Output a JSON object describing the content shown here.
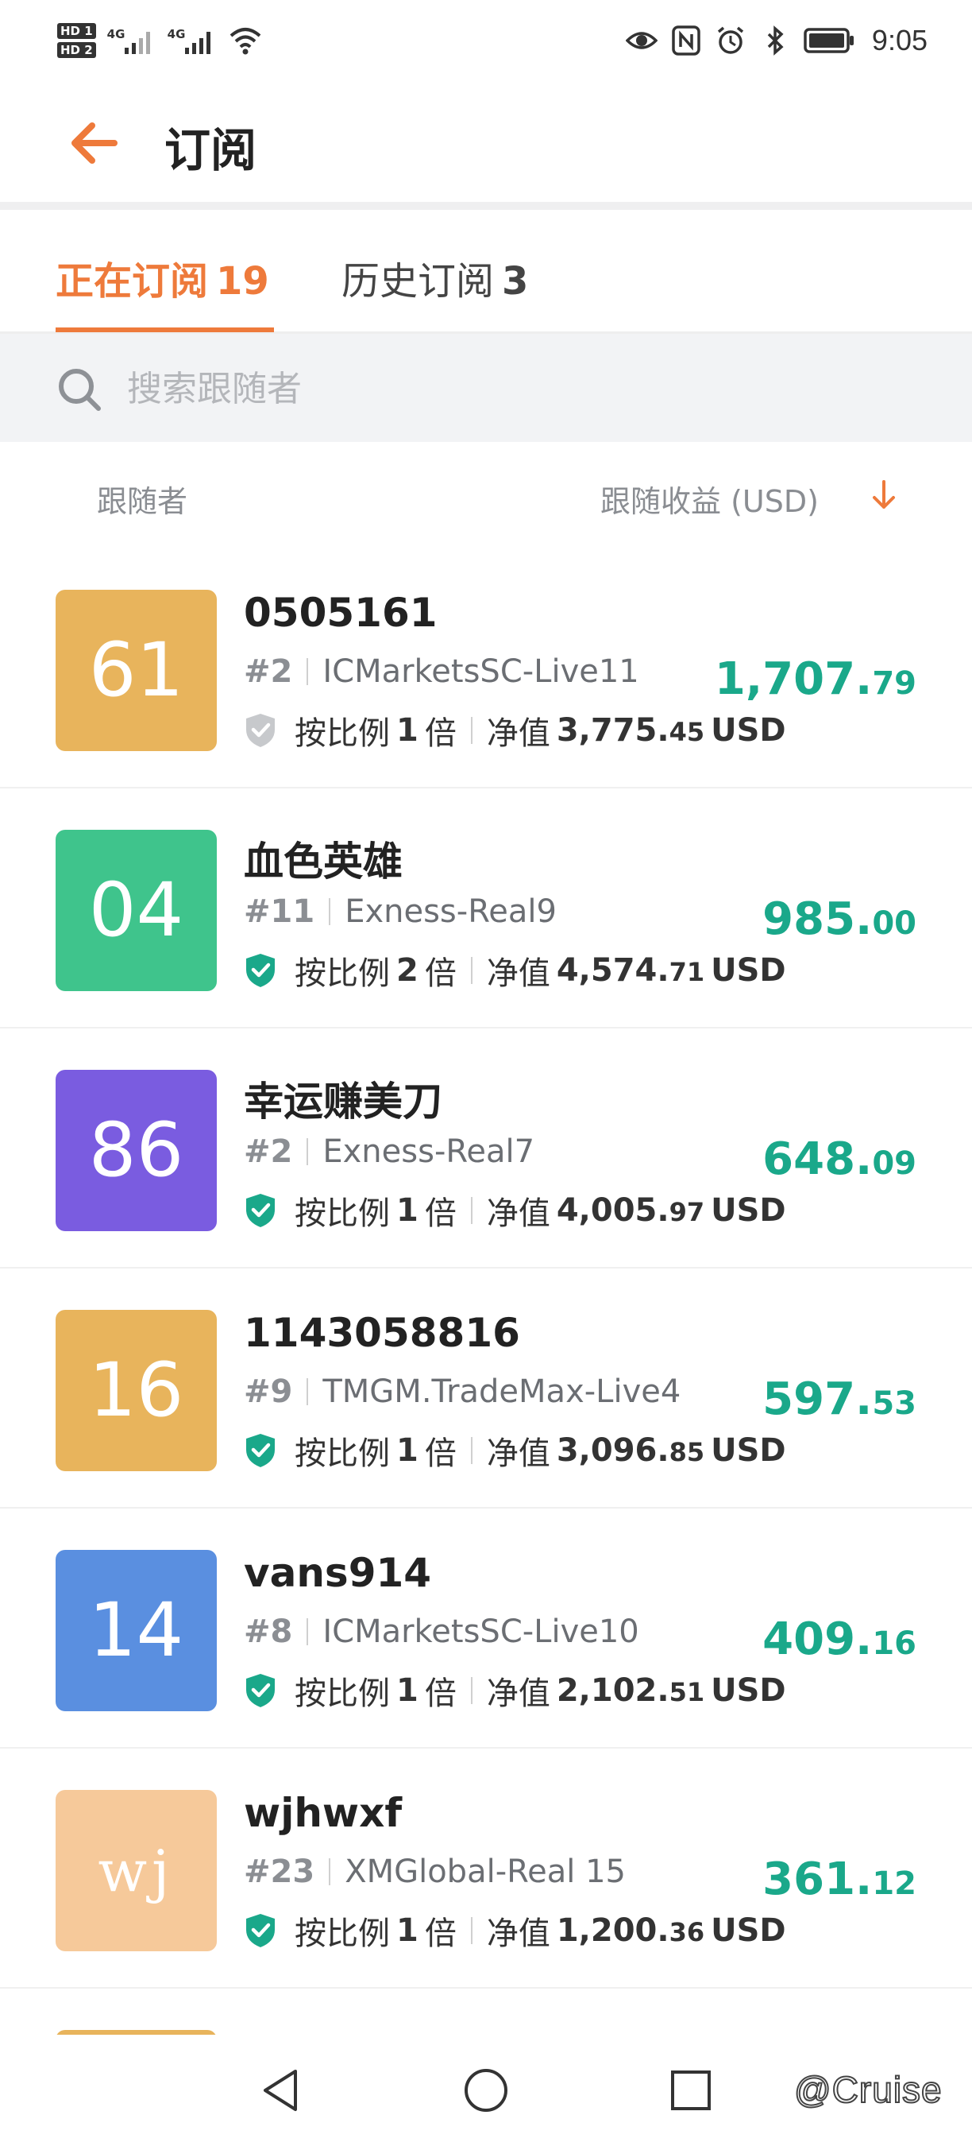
{
  "status_bar": {
    "hd1": "HD 1",
    "hd2": "HD 2",
    "network1": "4G",
    "network2": "4G",
    "time": "9:05"
  },
  "header": {
    "title": "订阅"
  },
  "tabs": [
    {
      "label": "正在订阅",
      "count": "19",
      "active": true
    },
    {
      "label": "历史订阅",
      "count": "3",
      "active": false
    }
  ],
  "search": {
    "placeholder": "搜索跟随者"
  },
  "list_header": {
    "left": "跟随者",
    "right": "跟随收益 (USD)"
  },
  "items": [
    {
      "avatar": "61",
      "avatar_color": "#e8b45c",
      "name": "0505161",
      "rank": "#2",
      "server": "ICMarketsSC-Live11",
      "verified": false,
      "ratio_label": "按比例",
      "ratio": "1",
      "ratio_unit": "倍",
      "equity_label": "净值",
      "equity_int": "3,775.",
      "equity_dec": "45",
      "currency": "USD",
      "earn_int": "1,707.",
      "earn_dec": "79"
    },
    {
      "avatar": "04",
      "avatar_color": "#3fc48c",
      "name": "血色英雄",
      "rank": "#11",
      "server": "Exness-Real9",
      "verified": true,
      "ratio_label": "按比例",
      "ratio": "2",
      "ratio_unit": "倍",
      "equity_label": "净值",
      "equity_int": "4,574.",
      "equity_dec": "71",
      "currency": "USD",
      "earn_int": "985.",
      "earn_dec": "00"
    },
    {
      "avatar": "86",
      "avatar_color": "#7a5ce0",
      "name": "幸运赚美刀",
      "rank": "#2",
      "server": "Exness-Real7",
      "verified": true,
      "ratio_label": "按比例",
      "ratio": "1",
      "ratio_unit": "倍",
      "equity_label": "净值",
      "equity_int": "4,005.",
      "equity_dec": "97",
      "currency": "USD",
      "earn_int": "648.",
      "earn_dec": "09"
    },
    {
      "avatar": "16",
      "avatar_color": "#e8b45c",
      "name": "1143058816",
      "rank": "#9",
      "server": "TMGM.TradeMax-Live4",
      "verified": true,
      "ratio_label": "按比例",
      "ratio": "1",
      "ratio_unit": "倍",
      "equity_label": "净值",
      "equity_int": "3,096.",
      "equity_dec": "85",
      "currency": "USD",
      "earn_int": "597.",
      "earn_dec": "53"
    },
    {
      "avatar": "14",
      "avatar_color": "#5a8fe0",
      "name": "vans914",
      "rank": "#8",
      "server": "ICMarketsSC-Live10",
      "verified": true,
      "ratio_label": "按比例",
      "ratio": "1",
      "ratio_unit": "倍",
      "equity_label": "净值",
      "equity_int": "2,102.",
      "equity_dec": "51",
      "currency": "USD",
      "earn_int": "409.",
      "earn_dec": "16"
    },
    {
      "avatar": "wj",
      "avatar_color": "#f6c99a",
      "name": "wjhwxf",
      "rank": "#23",
      "server": "XMGlobal-Real 15",
      "verified": true,
      "ratio_label": "按比例",
      "ratio": "1",
      "ratio_unit": "倍",
      "equity_label": "净值",
      "equity_int": "1,200.",
      "equity_dec": "36",
      "currency": "USD",
      "earn_int": "361.",
      "earn_dec": "12"
    }
  ],
  "partial_item": {
    "avatar_color": "#e8b45c"
  },
  "colors": {
    "accent": "#ee7a3b",
    "profit": "#1aa88a",
    "verified": "#1aa88a",
    "unverified": "#c7c9cc"
  },
  "watermark": "@Cruise"
}
